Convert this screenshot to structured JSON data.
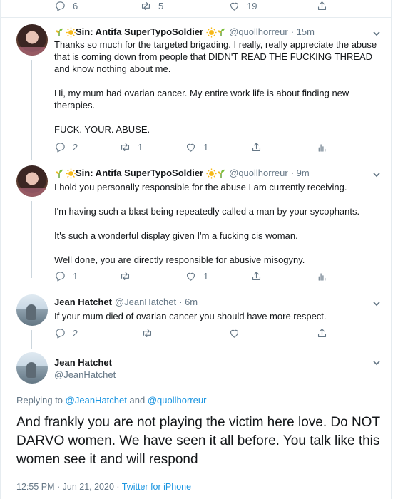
{
  "top_actions": {
    "reply_count": "6",
    "retweet_count": "5",
    "like_count": "19"
  },
  "tweets": [
    {
      "name": "Sin: Antifa SuperTypoSoldier",
      "handle": "@quollhorreur",
      "time": "· 15m",
      "paragraphs": [
        "Thanks so much for the targeted brigading. I really, really appreciate the abuse that is coming down from people that DIDN'T READ THE FUCKING THREAD and know nothing about me.",
        "Hi, my mum had ovarian cancer. My entire work life is about finding new therapies.",
        "FUCK. YOUR. ABUSE."
      ],
      "reply_count": "2",
      "retweet_count": "1",
      "like_count": "1"
    },
    {
      "name": "Sin: Antifa SuperTypoSoldier",
      "handle": "@quollhorreur",
      "time": "· 9m",
      "paragraphs": [
        "I hold you personally responsible for the abuse I am currently receiving.",
        "I'm having such a blast being repeatedly called a man by your sycophants.",
        "It's such a wonderful display  given I'm a fucking cis woman.",
        "Well done, you are directly responsible for abusive misogyny."
      ],
      "reply_count": "1",
      "retweet_count": "",
      "like_count": "1"
    },
    {
      "name": "Jean Hatchet",
      "handle": "@JeanHatchet",
      "time": "· 6m",
      "paragraphs": [
        "If your mum died of ovarian cancer you should have more respect."
      ],
      "reply_count": "2",
      "retweet_count": "",
      "like_count": ""
    }
  ],
  "main_tweet": {
    "name": "Jean Hatchet",
    "handle": "@JeanHatchet",
    "replying_prefix": "Replying to",
    "mention1": "@JeanHatchet",
    "and": "and",
    "mention2": "@quollhorreur",
    "text": "And frankly you are not playing the victim here love. Do NOT DARVO women. We have seen it all before. You talk like this women see it and will respond",
    "timestamp": "12:55 PM · Jun 21, 2020 · ",
    "source": "Twitter for iPhone"
  },
  "colors": {
    "accent": "#1b95e0",
    "secondary_text": "#657786",
    "border": "#e6ecf0",
    "thread_line": "#ccd6dd"
  }
}
